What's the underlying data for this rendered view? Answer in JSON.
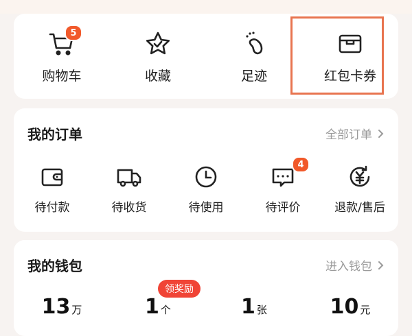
{
  "quick_actions": [
    {
      "label": "购物车",
      "icon": "cart-icon",
      "badge": "5"
    },
    {
      "label": "收藏",
      "icon": "star-icon"
    },
    {
      "label": "足迹",
      "icon": "footprint-icon"
    },
    {
      "label": "红包卡券",
      "icon": "wallet-card-icon"
    }
  ],
  "orders": {
    "title": "我的订单",
    "link": "全部订单",
    "items": [
      {
        "label": "待付款",
        "icon": "wallet-icon"
      },
      {
        "label": "待收货",
        "icon": "truck-icon"
      },
      {
        "label": "待使用",
        "icon": "clock-icon"
      },
      {
        "label": "待评价",
        "icon": "comment-icon",
        "badge": "4"
      },
      {
        "label": "退款/售后",
        "icon": "refund-icon"
      }
    ]
  },
  "wallet": {
    "title": "我的钱包",
    "link": "进入钱包",
    "reward_badge": "领奖励",
    "items": [
      {
        "value": "13",
        "unit": "万"
      },
      {
        "value": "1",
        "unit": "个"
      },
      {
        "value": "1",
        "unit": "张"
      },
      {
        "value": "10",
        "unit": "元"
      }
    ]
  },
  "colors": {
    "accent": "#f1592a",
    "highlight": "#e8744f",
    "reward": "#f04436"
  }
}
